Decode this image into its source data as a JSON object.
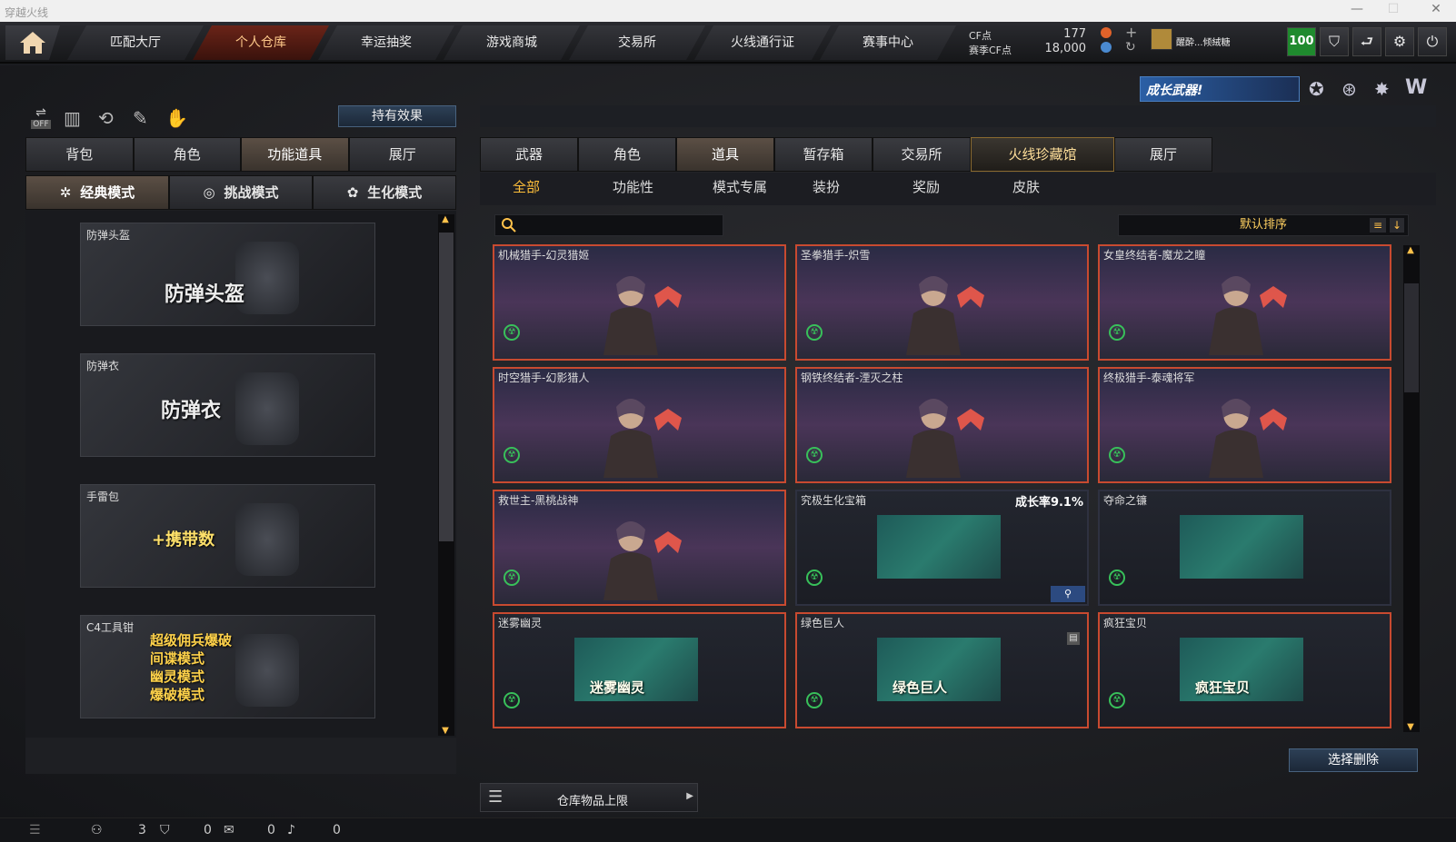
{
  "window": {
    "title": "穿越火线",
    "min": "—",
    "max": "☐",
    "close": "✕"
  },
  "topnav": {
    "tabs": [
      {
        "label": "匹配大厅"
      },
      {
        "label": "个人仓库",
        "active": true
      },
      {
        "label": "幸运抽奖"
      },
      {
        "label": "游戏商城"
      },
      {
        "label": "交易所"
      },
      {
        "label": "火线通行证"
      },
      {
        "label": "赛事中心"
      }
    ],
    "cf_label": "CF点",
    "cf_value": "177",
    "match_cf_label": "赛季CF点",
    "match_cf_value": "18,000",
    "player_name": "醒酔...倾絨糖",
    "level": "100",
    "add": "+",
    "refresh": "↻"
  },
  "effects_button": "持有效果",
  "off_label": "OFF",
  "left_tabs": [
    {
      "label": "背包"
    },
    {
      "label": "角色"
    },
    {
      "label": "功能道具",
      "active": true
    },
    {
      "label": "展厅"
    }
  ],
  "mode_tabs": [
    {
      "label": "经典模式",
      "active": true,
      "icon": "✲"
    },
    {
      "label": "挑战模式",
      "icon": "◎"
    },
    {
      "label": "生化模式",
      "icon": "✿"
    }
  ],
  "left_items": [
    {
      "label": "防弹头盔",
      "big": "防弹头盔"
    },
    {
      "label": "防弹衣",
      "big": "防弹衣"
    },
    {
      "label": "手雷包",
      "big": "+携带数"
    },
    {
      "label": "C4工具钳",
      "lines": [
        "超级佣兵爆破",
        "间谍模式",
        "幽灵模式",
        "爆破模式"
      ]
    }
  ],
  "right_tabs": [
    {
      "label": "武器"
    },
    {
      "label": "角色"
    },
    {
      "label": "道具",
      "active": true
    },
    {
      "label": "暂存箱"
    },
    {
      "label": "交易所"
    },
    {
      "label": "火线珍藏馆",
      "gold": true
    },
    {
      "label": "展厅"
    }
  ],
  "sub_tabs": [
    {
      "label": "全部",
      "active": true
    },
    {
      "label": "功能性"
    },
    {
      "label": "模式专属"
    },
    {
      "label": "装扮"
    },
    {
      "label": "奖励"
    },
    {
      "label": "皮肤"
    }
  ],
  "search_placeholder": "",
  "sort_label": "默认排序",
  "growth_banner": "成长武器!",
  "cards": [
    {
      "name": "机械猎手-幻灵猎姬",
      "style": "purple"
    },
    {
      "name": "圣拳猎手-炽雪",
      "style": "purple"
    },
    {
      "name": "女皇终结者-魔龙之瞳",
      "style": "purple"
    },
    {
      "name": "时空猎手-幻影猎人",
      "style": "purple"
    },
    {
      "name": "钢铁终结者-湮灭之柱",
      "style": "purple"
    },
    {
      "name": "终极猎手-泰魂将军",
      "style": "purple"
    },
    {
      "name": "救世主-黑桃战神",
      "style": "purple"
    },
    {
      "name": "究极生化宝箱",
      "rate": "成长率9.1%",
      "style": "plain"
    },
    {
      "name": "夺命之镰",
      "style": "plain"
    },
    {
      "name": "迷雾幽灵",
      "img_text": "迷雾幽灵",
      "style": "red2"
    },
    {
      "name": "绿色巨人",
      "img_text": "绿色巨人",
      "style": "red2"
    },
    {
      "name": "疯狂宝贝",
      "img_text": "疯狂宝贝",
      "style": "red2"
    }
  ],
  "delete_button": "选择删除",
  "warehouse_limit": "仓库物品上限",
  "bottom": {
    "a": "3",
    "b": "0",
    "c": "0",
    "d": "0"
  }
}
